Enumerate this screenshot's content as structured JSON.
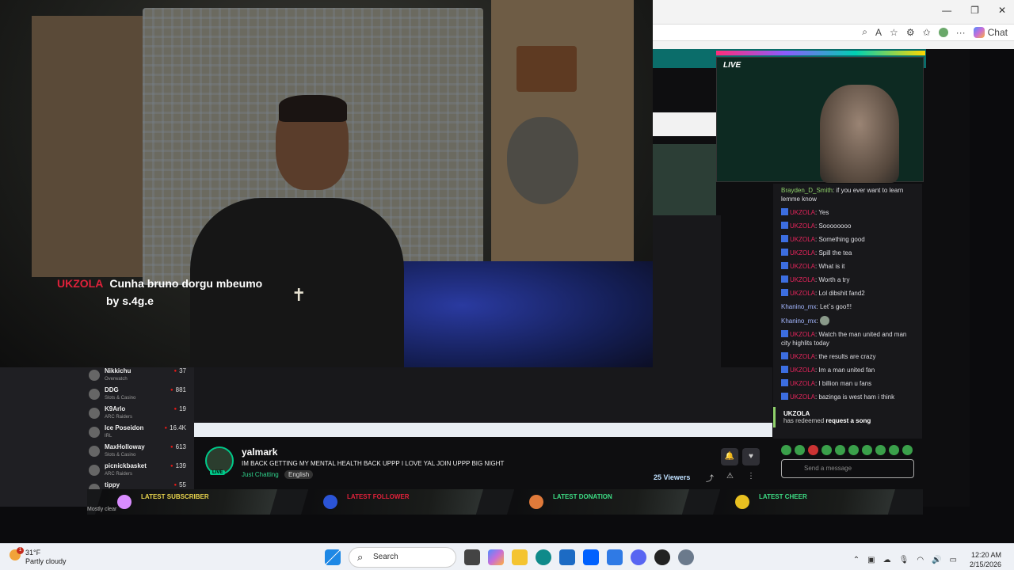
{
  "browser": {
    "window_controls": [
      "—",
      "❐",
      "✕"
    ],
    "toolbar_icons": [
      "zoom-icon",
      "read-aloud-icon",
      "favorite-icon",
      "extensions-icon",
      "favorites-icon",
      "profile-icon",
      "more-icon"
    ],
    "read_aloud": "A",
    "more": "···",
    "chat_label": "Chat"
  },
  "overlay": {
    "user": "UKZOLA",
    "song": "Cunha bruno dorgu mbeumo",
    "by": "by s.4g.e"
  },
  "live_tag": "LIVE",
  "chat": {
    "messages": [
      {
        "user": "Brayden_D_Smith",
        "text": "if you ever want to learn lemme know",
        "style": "n2",
        "badge": false
      },
      {
        "user": "UKZOLA",
        "text": "Yes",
        "style": "n1",
        "badge": true
      },
      {
        "user": "UKZOLA",
        "text": "Soooooooo",
        "style": "n1",
        "badge": true
      },
      {
        "user": "UKZOLA",
        "text": "Something good",
        "style": "n1",
        "badge": true
      },
      {
        "user": "UKZOLA",
        "text": "Spill the tea",
        "style": "n1",
        "badge": true
      },
      {
        "user": "UKZOLA",
        "text": "What is it",
        "style": "n1",
        "badge": true
      },
      {
        "user": "UKZOLA",
        "text": "Worth a try",
        "style": "n1",
        "badge": true
      },
      {
        "user": "UKZOLA",
        "text": "Lol dibshit fand2",
        "style": "n1",
        "badge": true
      },
      {
        "user": "Khanino_mx",
        "text": "Let`s goo!!!",
        "style": "n3",
        "badge": false
      },
      {
        "user": "Khanino_mx",
        "text": "",
        "style": "n3",
        "badge": false
      },
      {
        "user": "UKZOLA",
        "text": "Watch the man united and man city highlits today",
        "style": "n1",
        "badge": true
      },
      {
        "user": "UKZOLA",
        "text": "the results are crazy",
        "style": "n1",
        "badge": true
      },
      {
        "user": "UKZOLA",
        "text": "Im a man united fan",
        "style": "n1",
        "badge": true
      },
      {
        "user": "UKZOLA",
        "text": "I billion man u fans",
        "style": "n1",
        "badge": true
      },
      {
        "user": "UKZOLA",
        "text": "bazinga is west ham i think",
        "style": "n1",
        "badge": true
      }
    ],
    "redeem_user": "UKZOLA",
    "redeem_text": "has redeemed",
    "redeem_reward": "request a song",
    "input_placeholder": "Send a message"
  },
  "sidebar": {
    "channels": [
      {
        "name": "Nikkichu",
        "game": "Overwatch",
        "viewers": "37"
      },
      {
        "name": "DDG",
        "game": "Slots & Casino",
        "viewers": "881"
      },
      {
        "name": "K9Arlo",
        "game": "ARC Raiders",
        "viewers": "19"
      },
      {
        "name": "Ice Poseidon",
        "game": "IRL",
        "viewers": "16.4K"
      },
      {
        "name": "MaxHolloway",
        "game": "Slots & Casino",
        "viewers": "613"
      },
      {
        "name": "picnickbasket",
        "game": "ARC Raiders",
        "viewers": "139"
      },
      {
        "name": "tippy",
        "game": "",
        "viewers": "55"
      }
    ]
  },
  "stream": {
    "channel": "yalmark",
    "title": "IM BACK GETTING MY MENTAL HEALTH BACK UPPP I LOVE YAL JOIN UPPP BIG NIGHT",
    "category": "Just Chatting",
    "language": "English",
    "viewers": "25 Viewers",
    "live_badge": "LIVE"
  },
  "alerts": [
    {
      "label": "LATEST SUBSCRIBER",
      "color": "#e8d44d",
      "icon_color": "#d98cff"
    },
    {
      "label": "LATEST FOLLOWER",
      "color": "#e0213a",
      "icon_color": "#2b54d6"
    },
    {
      "label": "LATEST DONATION",
      "color": "#3ddc84",
      "icon_color": "#e07a3a"
    },
    {
      "label": "LATEST CHEER",
      "color": "#3ddc84",
      "icon_color": "#e8c020"
    }
  ],
  "mini_weather": "Mostly clear",
  "taskbar": {
    "temp": "31°F",
    "condition": "Partly cloudy",
    "notif_count": "1",
    "search": "Search",
    "time": "12:20 AM",
    "date": "2/15/2026"
  }
}
